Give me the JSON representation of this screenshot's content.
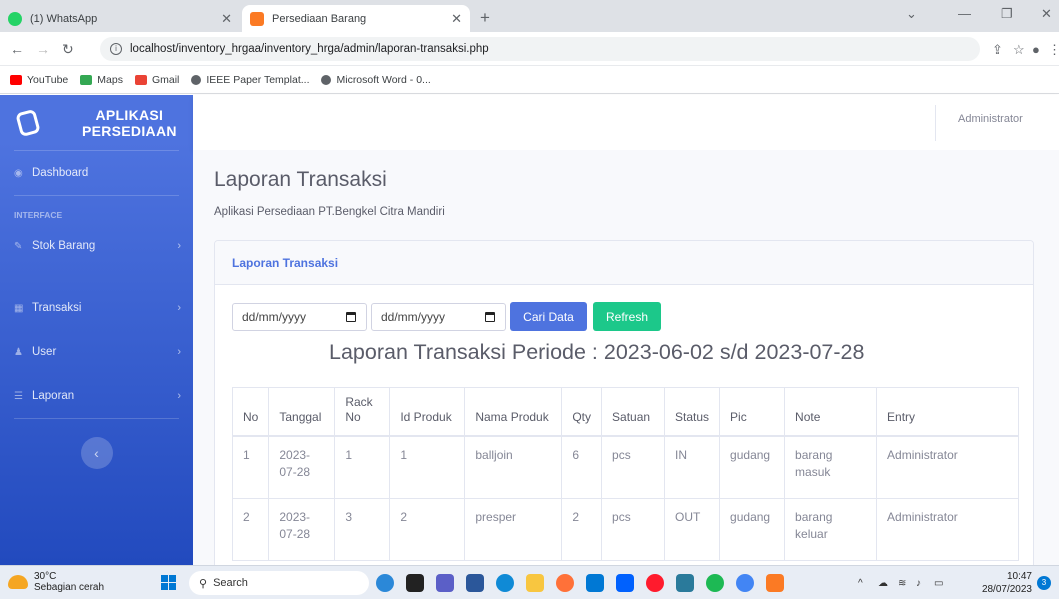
{
  "browser": {
    "tabs": [
      {
        "title": "(1) WhatsApp",
        "icon": "whatsapp-icon",
        "color": "#25d366"
      },
      {
        "title": "Persediaan Barang",
        "icon": "xampp-icon",
        "color": "#fb7a24"
      }
    ],
    "url": "localhost/inventory_hrgaa/inventory_hrga/admin/laporan-transaksi.php",
    "bookmarks": [
      {
        "label": "YouTube",
        "color": "#ff0000"
      },
      {
        "label": "Maps",
        "color": "#34a853"
      },
      {
        "label": "Gmail",
        "color": "#ea4335"
      },
      {
        "label": "IEEE Paper Templat...",
        "color": "#5f6368"
      },
      {
        "label": "Microsoft Word - 0...",
        "color": "#5f6368"
      }
    ]
  },
  "sidebar": {
    "brand": "APLIKASI PERSEDIAAN",
    "dashboard": "Dashboard",
    "heading": "INTERFACE",
    "items": [
      {
        "label": "Stok Barang"
      },
      {
        "label": "Transaksi"
      },
      {
        "label": "User"
      },
      {
        "label": "Laporan"
      }
    ],
    "toggle": "‹"
  },
  "topbar": {
    "user": "Administrator"
  },
  "page": {
    "title": "Laporan Transaksi",
    "subtitle": "Aplikasi Persediaan PT.Bengkel Citra Mandiri"
  },
  "card": {
    "header": "Laporan Transaksi",
    "date_placeholder_1": "dd/mm/yyyy",
    "date_placeholder_2": "dd/mm/yyyy",
    "search_button": "Cari Data",
    "refresh_button": "Refresh",
    "report_title": "Laporan Transaksi Periode : 2023-06-02 s/d 2023-07-28"
  },
  "table": {
    "headers": [
      "No",
      "Tanggal",
      "Rack No",
      "Id Produk",
      "Nama Produk",
      "Qty",
      "Satuan",
      "Status",
      "Pic",
      "Note",
      "Entry"
    ],
    "rows": [
      [
        "1",
        "2023-07-28",
        "1",
        "1",
        "balljoin",
        "6",
        "pcs",
        "IN",
        "gudang",
        "barang masuk",
        "Administrator"
      ],
      [
        "2",
        "2023-07-28",
        "3",
        "2",
        "presper",
        "2",
        "pcs",
        "OUT",
        "gudang",
        "barang keluar",
        "Administrator"
      ]
    ]
  },
  "taskbar": {
    "weather_temp": "30°C",
    "weather_desc": "Sebagian cerah",
    "search": "Search",
    "time": "10:47",
    "date": "28/07/2023",
    "notifications": "3"
  }
}
